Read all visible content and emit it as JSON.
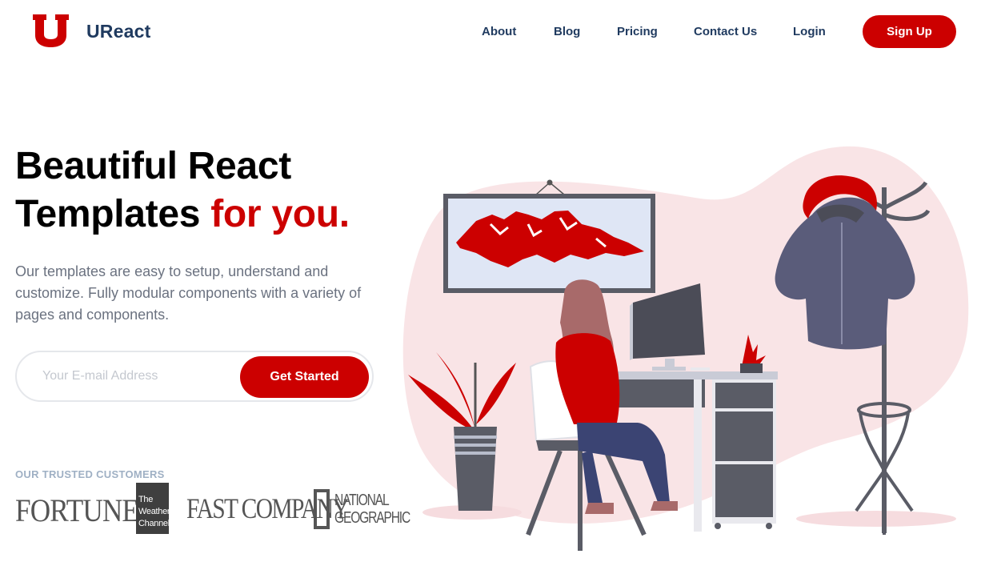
{
  "brand": {
    "name": "UReact",
    "logo_letter": "U",
    "accent_color": "#cc0000",
    "text_color": "#1f3a5f"
  },
  "nav": {
    "links": [
      {
        "label": "About"
      },
      {
        "label": "Blog"
      },
      {
        "label": "Pricing"
      },
      {
        "label": "Contact Us"
      },
      {
        "label": "Login"
      }
    ],
    "signup_label": "Sign Up"
  },
  "hero": {
    "title_line1": "Beautiful React",
    "title_line2": "Templates",
    "title_accent": "for you.",
    "description": "Our templates are easy to setup, understand and customize. Fully modular components with a variety of pages and components.",
    "email_placeholder": "Your E-mail Address",
    "cta_label": "Get Started"
  },
  "customers": {
    "label": "OUR TRUSTED CUSTOMERS",
    "logos": [
      {
        "name": "fortune-logo",
        "text": "FORTUNE"
      },
      {
        "name": "weather-channel-logo",
        "lines": [
          "The",
          "Weather",
          "Channel"
        ]
      },
      {
        "name": "fast-company-logo",
        "text": "FAST COMPANY"
      },
      {
        "name": "national-geographic-logo",
        "lines": [
          "NATIONAL",
          "GEOGRAPHIC"
        ]
      }
    ]
  }
}
